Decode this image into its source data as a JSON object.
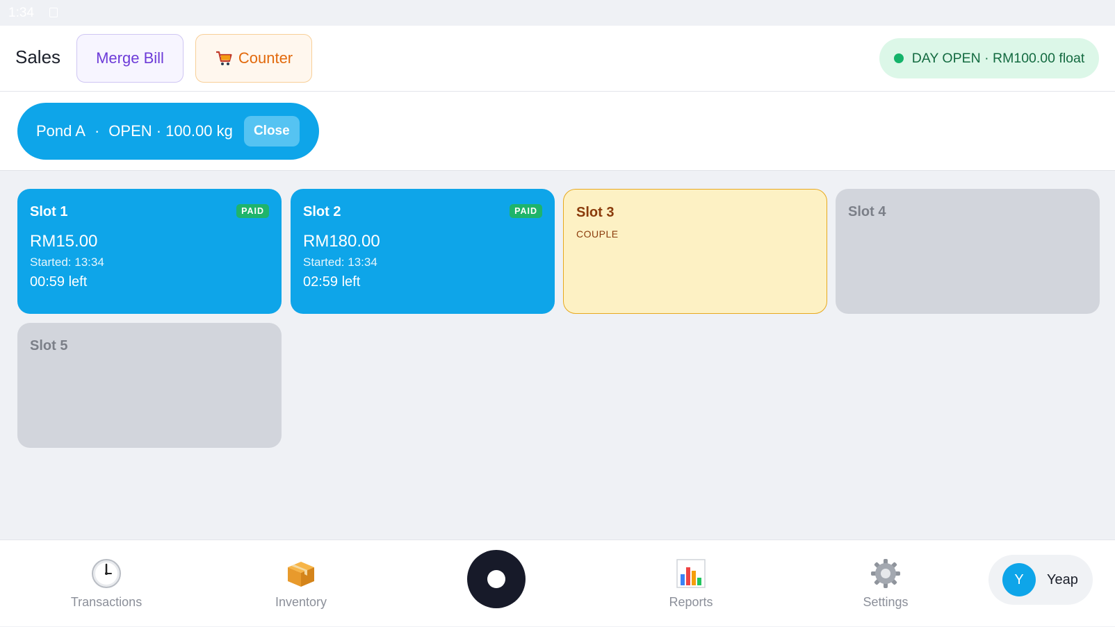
{
  "status_bar": {
    "time": "1:34"
  },
  "header": {
    "title": "Sales",
    "merge_bill_label": "Merge Bill",
    "counter_label": "Counter",
    "counter_icon": "shopping-cart-icon",
    "day_status": "DAY OPEN · RM100.00 float"
  },
  "pond": {
    "name": "Pond A",
    "separator": "·",
    "status": "OPEN · 100.00 kg",
    "close_label": "Close"
  },
  "slots": [
    {
      "title": "Slot 1",
      "badge": "PAID",
      "amount": "RM15.00",
      "started": "Started: 13:34",
      "left": "00:59 left",
      "state": "paid"
    },
    {
      "title": "Slot 2",
      "badge": "PAID",
      "amount": "RM180.00",
      "started": "Started: 13:34",
      "left": "02:59 left",
      "state": "paid"
    },
    {
      "title": "Slot 3",
      "tag": "COUPLE",
      "state": "couple"
    },
    {
      "title": "Slot 4",
      "state": "empty"
    },
    {
      "title": "Slot 5",
      "state": "empty"
    }
  ],
  "bottom_nav": {
    "items": [
      {
        "label": "Transactions",
        "icon": "clock-icon"
      },
      {
        "label": "Inventory",
        "icon": "package-icon"
      },
      {
        "label": "Reports",
        "icon": "bar-chart-icon"
      },
      {
        "label": "Settings",
        "icon": "gear-icon"
      }
    ],
    "user": {
      "initial": "Y",
      "name": "Yeap"
    }
  },
  "colors": {
    "primary": "#0ea5e9",
    "paid_badge": "#1fb46b",
    "couple_bg": "#fdf1c4",
    "couple_border": "#e7a91e",
    "empty_slot": "#d2d5dc",
    "merge_text": "#6d3bd8",
    "counter_text": "#e2690c",
    "day_open_bg": "#dcf7e8"
  }
}
